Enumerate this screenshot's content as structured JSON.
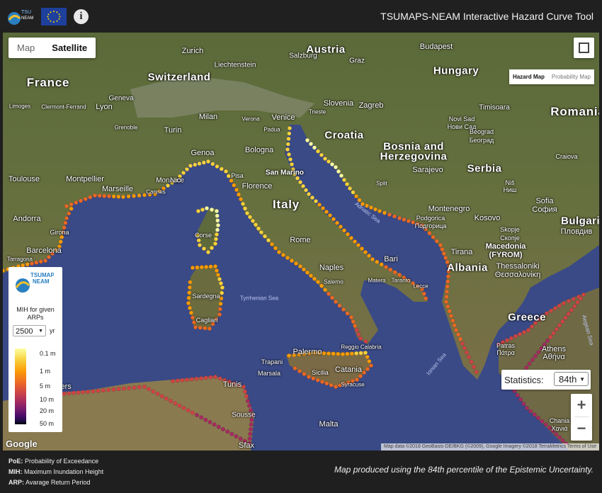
{
  "header": {
    "title": "TSUMAPS-NEAM Interactive Hazard Curve Tool",
    "info_symbol": "i"
  },
  "map_controls": {
    "map_label": "Map",
    "satellite_label": "Satellite",
    "hazard_label": "Hazard Map",
    "probability_label": "Probability Map",
    "zoom_in": "+",
    "zoom_out": "−"
  },
  "statistics": {
    "label": "Statistics:",
    "value": "84th"
  },
  "legend": {
    "logo_text": "TSUMAPS NEAM",
    "title": "MIH for given ARPs",
    "arp_value": "2500",
    "arp_unit": "yr",
    "ticks": [
      "0.1 m",
      "1 m",
      "5 m",
      "10 m",
      "20 m",
      "50 m"
    ]
  },
  "map_labels": {
    "countries": [
      "France",
      "Switzerland",
      "Austria",
      "Hungary",
      "Italy",
      "Bosnia and",
      "Herzegovina",
      "Serbia",
      "Croatia",
      "Romania",
      "Bulgaria",
      "Albania",
      "Greece",
      "Montenegro",
      "Kosovo",
      "Macedonia",
      "(FYROM)"
    ],
    "cities": [
      "Salzburg",
      "Zurich",
      "Liechtenstein",
      "Budapest",
      "Graz",
      "Geneva",
      "Lyon",
      "Clermont-Ferrand",
      "Limoges",
      "Grenoble",
      "Turin",
      "Milan",
      "Verona",
      "Venice",
      "Padua",
      "Trieste",
      "Slovenia",
      "Zagreb",
      "Novi Sad",
      "Нови Сад",
      "Timisoara",
      "Beograd",
      "Београд",
      "Genoa",
      "Bologna",
      "Pisa",
      "Florence",
      "San Marino",
      "Sarajevo",
      "Craiova",
      "Toulouse",
      "Montpellier",
      "Marseille",
      "Cannes",
      "Monaco",
      "Nice",
      "Split",
      "Niš",
      "Ниш",
      "Sofia",
      "София",
      "Plovdiv",
      "Пловдив",
      "Andorra",
      "Girona",
      "Corse",
      "Rome",
      "Podgorica",
      "Подгорица",
      "Skopje",
      "Скопје",
      "Barcelona",
      "Tarragona",
      "Naples",
      "Bari",
      "Tirana",
      "Thessaloniki",
      "Θεσσαλονίκη",
      "Sardegna",
      "Cagliari",
      "Salerno",
      "Matera",
      "Taranto",
      "Lecce",
      "Palermo",
      "Trapani",
      "Marsala",
      "Sicilia",
      "Catania",
      "Reggio Calabria",
      "Syracuse",
      "Malta",
      "Patras",
      "Πάτρα",
      "Athens",
      "Αθήνα",
      "Tunis",
      "Sousse",
      "Sfax",
      "Algiers",
      "Chania",
      "Χανιά"
    ],
    "seas": [
      "Adriatic Sea",
      "Tyrrhenian Sea",
      "Ionian Sea",
      "Aegean Sea"
    ]
  },
  "attribution": "Map data ©2018 GeoBasis-DE/BKG (©2009), Google Imagery ©2018 TerraMetrics  Terms of Use",
  "google": "Google",
  "footer": {
    "poe_abbr": "PoE:",
    "poe_text": "Probability of Exceedance",
    "mih_abbr": "MIH:",
    "mih_text": "Maximum Inundation Height",
    "arp_abbr": "ARP:",
    "arp_text": "Avarage Return Period",
    "note": "Map produced using the 84th percentile of the Epistemic Uncertainty."
  },
  "colors": {
    "water": "#3a4a86",
    "land": "#5d6b3b",
    "hazard_low": "#fcffa4",
    "hazard_high": "#000004"
  }
}
